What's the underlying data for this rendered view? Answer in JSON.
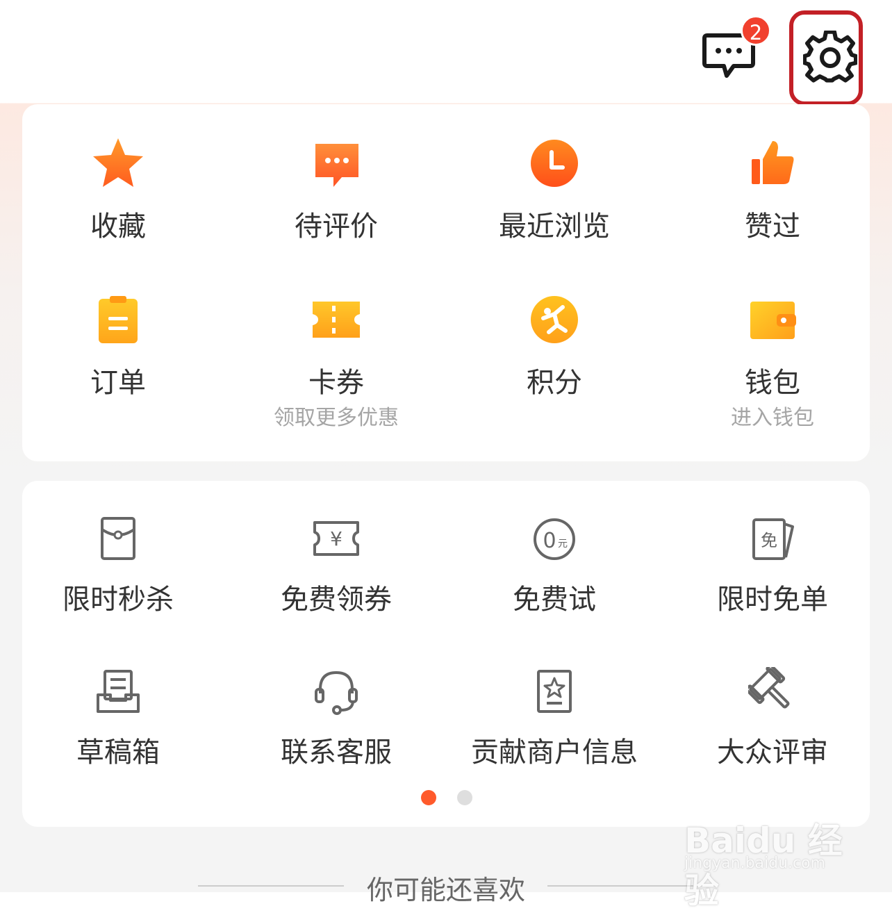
{
  "header": {
    "message_badge_count": "2",
    "message_icon": "chat-bubble-icon",
    "settings_icon": "gear-icon"
  },
  "annotation": {
    "highlight_color": "#c32026"
  },
  "my_services": [
    {
      "label": "收藏",
      "icon": "star-icon"
    },
    {
      "label": "待评价",
      "icon": "comment-icon"
    },
    {
      "label": "最近浏览",
      "icon": "clock-icon"
    },
    {
      "label": "赞过",
      "icon": "thumbs-up-icon"
    },
    {
      "label": "订单",
      "icon": "clipboard-icon"
    },
    {
      "label": "卡券",
      "sub": "领取更多优惠",
      "icon": "ticket-icon"
    },
    {
      "label": "积分",
      "icon": "points-icon"
    },
    {
      "label": "钱包",
      "sub": "进入钱包",
      "icon": "wallet-icon"
    }
  ],
  "more_services": [
    {
      "label": "限时秒杀",
      "icon": "red-envelope-icon"
    },
    {
      "label": "免费领券",
      "icon": "yen-coupon-icon"
    },
    {
      "label": "免费试",
      "icon": "zero-yuan-icon"
    },
    {
      "label": "限时免单",
      "icon": "free-ticket-icon"
    },
    {
      "label": "草稿箱",
      "icon": "draft-box-icon"
    },
    {
      "label": "联系客服",
      "icon": "headset-icon"
    },
    {
      "label": "贡献商户信息",
      "icon": "shop-info-icon"
    },
    {
      "label": "大众评审",
      "icon": "gavel-icon"
    }
  ],
  "pager": {
    "active_page": 1,
    "total_pages": 2
  },
  "footer": {
    "title": "你可能还喜欢"
  },
  "watermark": {
    "brand": "Baidu 经验",
    "url": "jingyan.baidu.com"
  },
  "colors": {
    "accent": "#ff5a2b",
    "badge": "#f1402e",
    "icon_orange": "#ff7a1f"
  }
}
